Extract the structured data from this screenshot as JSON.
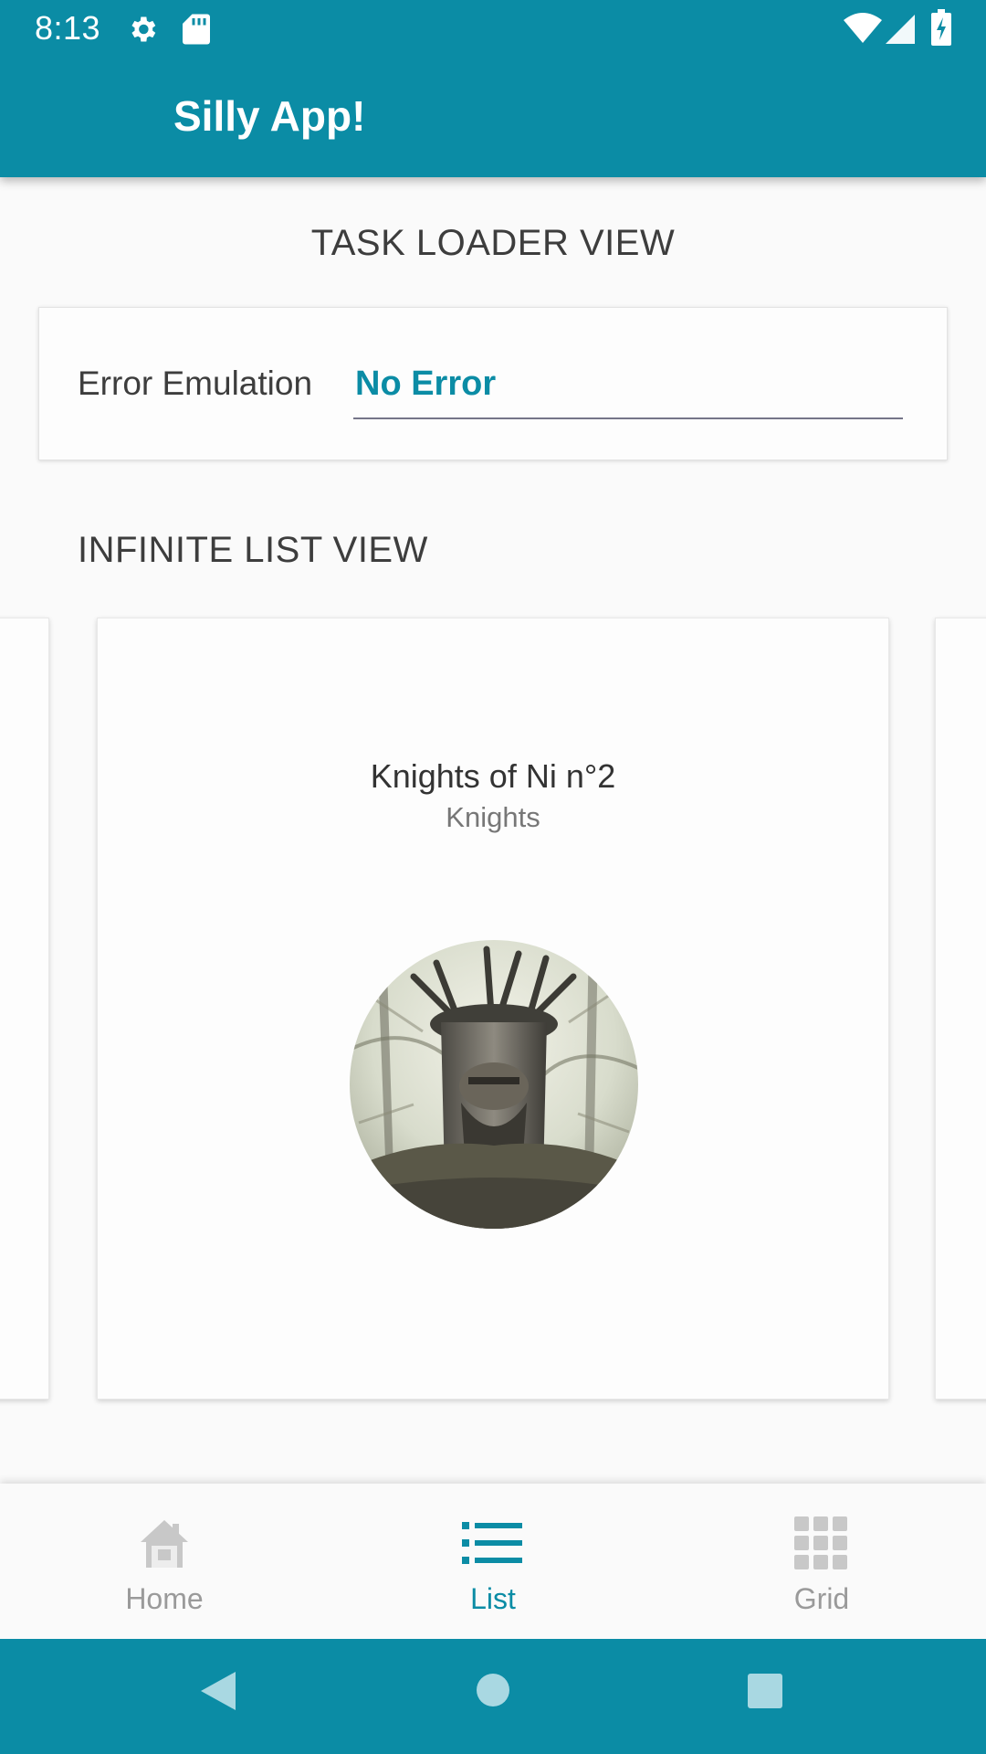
{
  "status_bar": {
    "time": "8:13",
    "icons": [
      "gear-icon",
      "sd-card-icon",
      "wifi-icon",
      "cell-signal-icon",
      "battery-charging-icon"
    ]
  },
  "app_bar": {
    "title": "Silly App!"
  },
  "task_loader": {
    "title": "TASK LOADER VIEW",
    "error_label": "Error Emulation",
    "error_value": "No Error"
  },
  "infinite_list": {
    "title": "INFINITE LIST VIEW",
    "current_card": {
      "title": "Knights of Ni n°2",
      "subtitle": "Knights",
      "image": "knight-of-ni-avatar"
    }
  },
  "bottom_nav": {
    "items": [
      {
        "label": "Home",
        "icon": "home-icon",
        "active": false
      },
      {
        "label": "List",
        "icon": "list-icon",
        "active": true
      },
      {
        "label": "Grid",
        "icon": "grid-icon",
        "active": false
      }
    ]
  },
  "system_nav": {
    "buttons": [
      "back-button",
      "home-button",
      "recents-button"
    ]
  },
  "colors": {
    "primary": "#0b8ca5",
    "background": "#fafafa",
    "text": "#3d3d3d",
    "inactive": "#9a9a9a"
  }
}
